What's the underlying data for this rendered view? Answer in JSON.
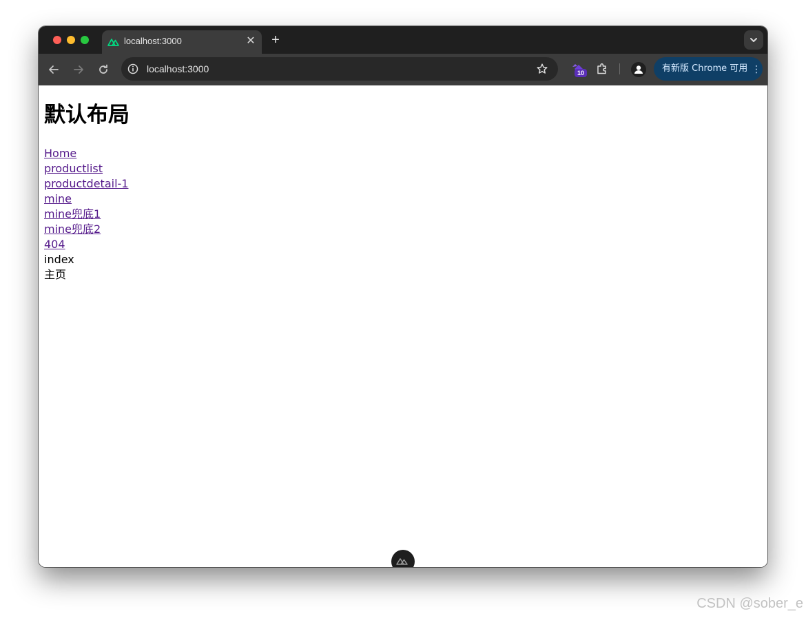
{
  "browser": {
    "tab_title": "localhost:3000",
    "url": "localhost:3000",
    "extension_badge": "10",
    "update_button_label": "有新版 Chrome 可用",
    "icons": {
      "tab_favicon": "nuxt-logo-icon",
      "back": "arrow-left-icon",
      "forward": "arrow-right-icon",
      "reload": "reload-icon",
      "site_info": "info-icon",
      "bookmark": "star-icon",
      "extension": "extension-badge-icon",
      "extensions_menu": "puzzle-icon",
      "profile": "profile-icon",
      "menu": "kebab-menu-icon",
      "new_tab": "plus-icon",
      "close_tab": "close-icon",
      "tab_search": "chevron-down-icon"
    },
    "colors": {
      "tabstrip": "#1f1f1f",
      "toolbar": "#3c3c3c",
      "update_pill": "#0f3f66",
      "nuxt_green": "#00dc82"
    }
  },
  "page": {
    "title": "默认布局",
    "links": [
      "Home",
      "productlist",
      "productdetail-1",
      "mine",
      "mine兜底1",
      "mine兜底2",
      "404"
    ],
    "texts": [
      "index",
      "主页"
    ]
  },
  "watermark": "CSDN @sober_e"
}
